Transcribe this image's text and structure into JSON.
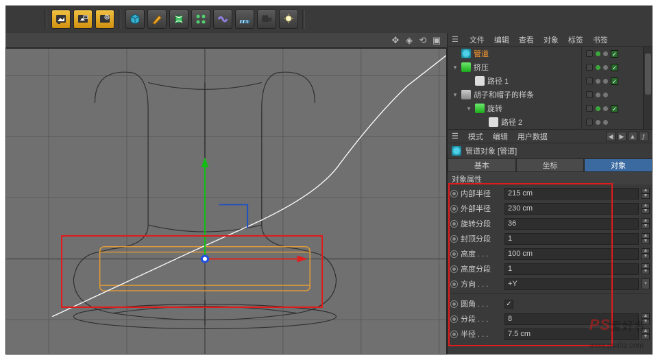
{
  "toolbar": {
    "icons": [
      "render-image",
      "render-region",
      "render-settings",
      "cube-prim",
      "pen-spline",
      "nurbs",
      "array-gen",
      "deformer",
      "floor",
      "camera",
      "light"
    ]
  },
  "viewport_header": {
    "icons": [
      "move",
      "axis",
      "view",
      "grid"
    ]
  },
  "objtree": {
    "menu": [
      "文件",
      "编辑",
      "查看",
      "对象",
      "标签",
      "书签"
    ],
    "items": [
      {
        "label": "管道",
        "indent": 0,
        "icon": "cyan",
        "exp": "",
        "selected": true
      },
      {
        "label": "挤压",
        "indent": 0,
        "icon": "green",
        "exp": "▾"
      },
      {
        "label": "路径 1",
        "indent": 1,
        "icon": "white",
        "exp": ""
      },
      {
        "label": "胡子和帽子的样条",
        "indent": 0,
        "icon": "gen",
        "exp": "▾"
      },
      {
        "label": "旋转",
        "indent": 0,
        "icon": "green",
        "exp": "▾"
      },
      {
        "label": "路径 2",
        "indent": 1,
        "icon": "white",
        "exp": ""
      }
    ]
  },
  "attr": {
    "menu": [
      "模式",
      "编辑",
      "用户数据"
    ],
    "title": "管道对象 [管道]",
    "tabs": [
      "基本",
      "坐标",
      "对象"
    ],
    "section": "对象属性",
    "props": [
      {
        "label": "内部半径",
        "value": "215 cm",
        "type": "num"
      },
      {
        "label": "外部半径",
        "value": "230 cm",
        "type": "num"
      },
      {
        "label": "旋转分段",
        "value": "36",
        "type": "num"
      },
      {
        "label": "封顶分段",
        "value": "1",
        "type": "num"
      },
      {
        "label": "高度 . . .",
        "value": "100 cm",
        "type": "num"
      },
      {
        "label": "高度分段",
        "value": "1",
        "type": "num"
      },
      {
        "label": "方向 . . .",
        "value": "+Y",
        "type": "select"
      }
    ],
    "props2": [
      {
        "label": "圆角 . . .",
        "value": "on",
        "type": "check"
      },
      {
        "label": "分段 . . .",
        "value": "8",
        "type": "num"
      },
      {
        "label": "半径 . . .",
        "value": "7.5 cm",
        "type": "num"
      }
    ]
  },
  "watermark": {
    "en": "PS",
    "cn": "爱好者",
    "url": "www.psahz.com"
  }
}
